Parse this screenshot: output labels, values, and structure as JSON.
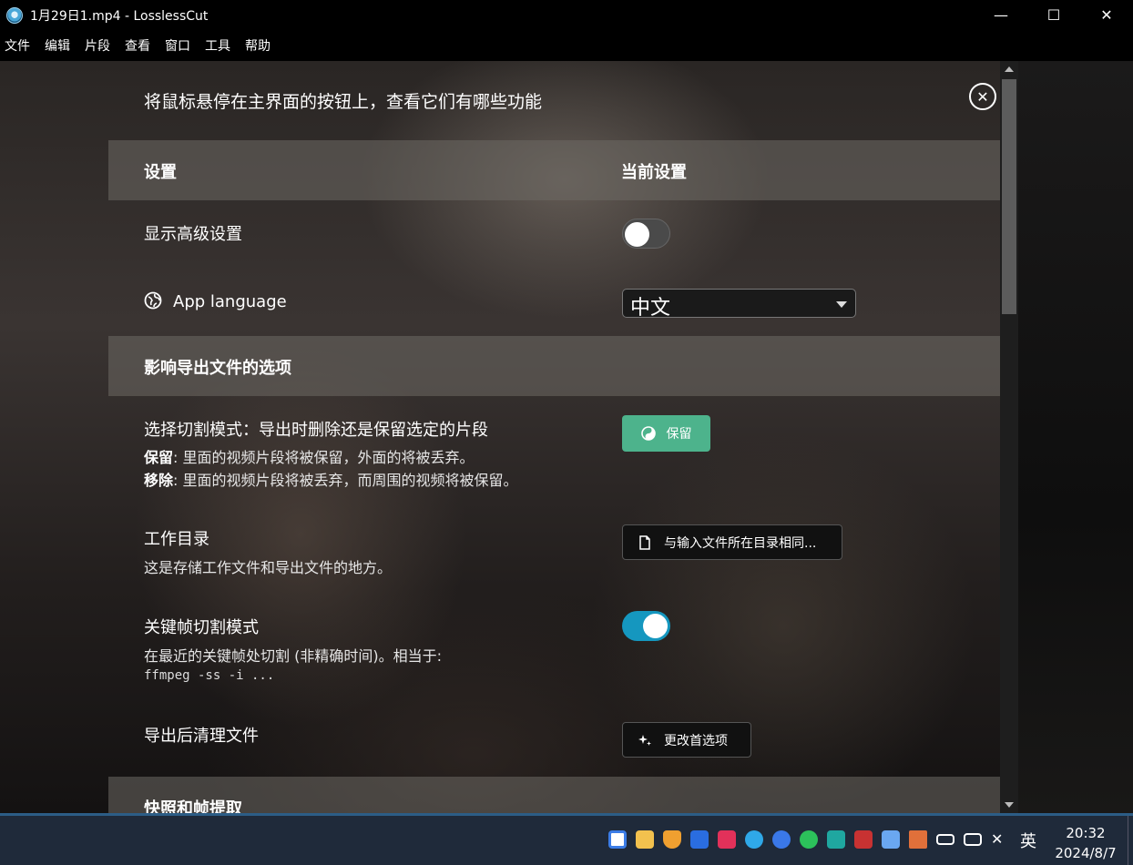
{
  "window": {
    "title": "1月29日1.mp4 - LosslessCut",
    "minimize": "—",
    "maximize": "☐",
    "close": "✕"
  },
  "menu": [
    "文件",
    "编辑",
    "片段",
    "查看",
    "窗口",
    "工具",
    "帮助"
  ],
  "settings": {
    "hint": "将鼠标悬停在主界面的按钮上，查看它们有哪些功能",
    "close_icon": "✕",
    "header": {
      "col1": "设置",
      "col2": "当前设置"
    },
    "advanced": {
      "label": "显示高级设置",
      "enabled": false
    },
    "language": {
      "label": "App language",
      "value": "中文"
    },
    "export_section": "影响导出文件的选项",
    "cut_mode": {
      "label": "选择切割模式：导出时删除还是保留选定的片段",
      "keep_term": "保留",
      "keep_desc": ": 里面的视频片段将被保留，外面的将被丢弃。",
      "remove_term": "移除",
      "remove_desc": ": 里面的视频片段将被丢弃，而周围的视频将被保留。",
      "button": "保留"
    },
    "work_dir": {
      "label": "工作目录",
      "desc": "这是存储工作文件和导出文件的地方。",
      "button": "与输入文件所在目录相同..."
    },
    "keyframe": {
      "label": "关键帧切割模式",
      "desc": "在最近的关键帧处切割 (非精确时间)。相当于:",
      "cmd": "ffmpeg -ss -i ...",
      "enabled": true
    },
    "cleanup": {
      "label": "导出后清理文件",
      "button": "更改首选项"
    },
    "snapshot_section": "快照和帧提取"
  },
  "taskbar": {
    "ime": "英",
    "time": "20:32",
    "date": "2024/8/7"
  },
  "colors": {
    "toggle_on": "#1597bf",
    "keep_button": "#4db38c",
    "taskbar": "#1f2a3a"
  }
}
